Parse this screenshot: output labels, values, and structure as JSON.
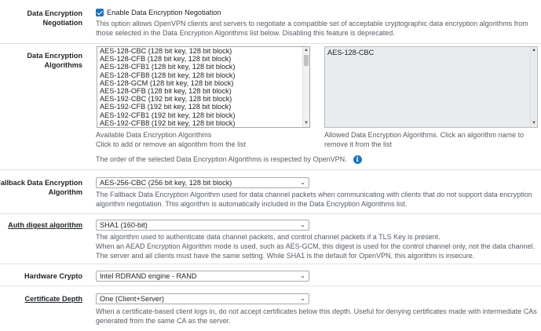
{
  "encryption_negotiation": {
    "label": "Data Encryption Negotiation",
    "checkbox_label": "Enable Data Encryption Negotiation",
    "checked": true,
    "help": "This option allows OpenVPN clients and servers to negotiate a compatible set of acceptable cryptographic data encryption algorithms from those selected in the Data Encryption Algorithms list below. Disabling this feature is deprecated."
  },
  "encryption_algorithms": {
    "label": "Data Encryption Algorithms",
    "available": [
      "AES-128-CBC (128 bit key, 128 bit block)",
      "AES-128-CFB (128 bit key, 128 bit block)",
      "AES-128-CFB1 (128 bit key, 128 bit block)",
      "AES-128-CFB8 (128 bit key, 128 bit block)",
      "AES-128-GCM (128 bit key, 128 bit block)",
      "AES-128-OFB (128 bit key, 128 bit block)",
      "AES-192-CBC (192 bit key, 128 bit block)",
      "AES-192-CFB (192 bit key, 128 bit block)",
      "AES-192-CFB1 (192 bit key, 128 bit block)",
      "AES-192-CFB8 (192 bit key, 128 bit block)"
    ],
    "selected": [
      "AES-128-CBC"
    ],
    "available_help_1": "Available Data Encryption Algorithms",
    "available_help_2": "Click to add or remove an algorithm from the list",
    "selected_help": "Allowed Data Encryption Algorithms. Click an algorithm name to remove it from the list",
    "order_note": "The order of the selected Data Encryption Algorithms is respected by OpenVPN."
  },
  "fallback": {
    "label": "Fallback Data Encryption Algorithm",
    "value": "AES-256-CBC (256 bit key, 128 bit block)",
    "help": "The Fallback Data Encryption Algorithm used for data channel packets when communicating with clients that do not support data encryption algorithm negotiation. This algorithm is automatically included in the Data Encryption Algorithms list."
  },
  "auth_digest": {
    "label": "Auth digest algorithm",
    "value": "SHA1 (160-bit)",
    "help_1": "The algorithm used to authenticate data channel packets, and control channel packets if a TLS Key is present.",
    "help_2": "When an AEAD Encryption Algorithm mode is used, such as AES-GCM, this digest is used for the control channel only, not the data channel.",
    "help_3": "The server and all clients must have the same setting. While SHA1 is the default for OpenVPN, this algorithm is insecure."
  },
  "hardware_crypto": {
    "label": "Hardware Crypto",
    "value": "Intel RDRAND engine - RAND"
  },
  "certificate_depth": {
    "label": "Certificate Depth",
    "value": "One (Client+Server)",
    "help": "When a certificate-based client logs in, do not accept certificates below this depth. Useful for denying certificates made with intermediate CAs generated from the same CA as the server."
  },
  "colors": {
    "accent": "#1e73be",
    "help_text": "#555d66",
    "border": "#dee2e6"
  },
  "icons": {
    "checkbox": "check-icon",
    "info": "info-icon",
    "dropdown": "chevron-down-icon"
  }
}
